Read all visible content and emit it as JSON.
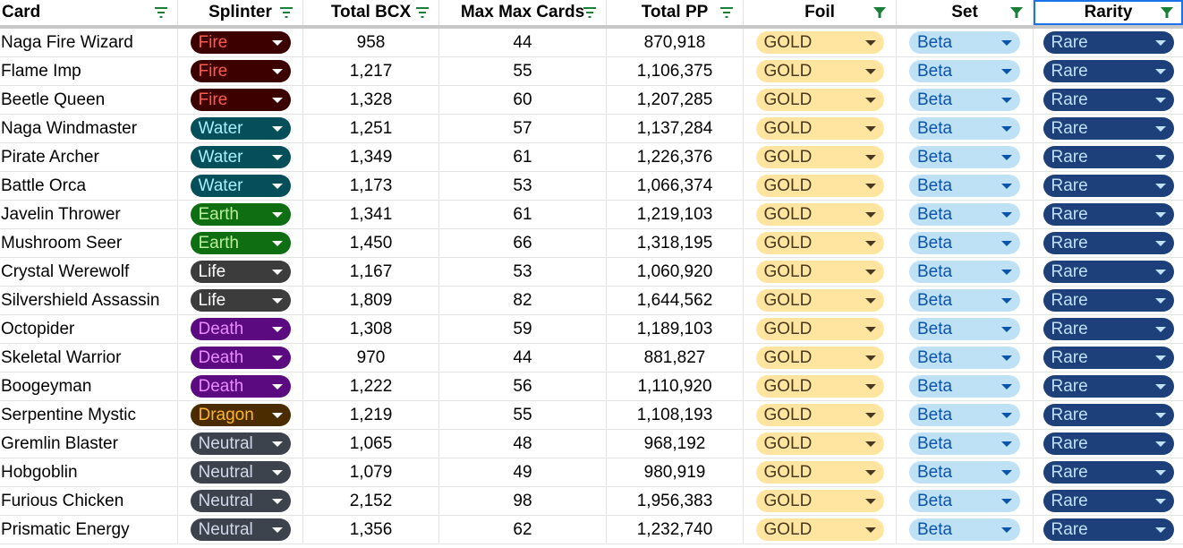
{
  "headers": {
    "card": "Card",
    "splinter": "Splinter",
    "total_bcx": "Total BCX",
    "max_max": "Max Max Cards",
    "total_pp": "Total PP",
    "foil": "Foil",
    "set": "Set",
    "rarity": "Rarity"
  },
  "filter_colors": {
    "inactive": "#188038",
    "active": "#188038"
  },
  "splinter_colors": {
    "Fire": {
      "bg": "#3d0000",
      "fg": "#ff5a4e"
    },
    "Water": {
      "bg": "#064e5a",
      "fg": "#a6f1fa"
    },
    "Earth": {
      "bg": "#0f6d12",
      "fg": "#b7f09a"
    },
    "Life": {
      "bg": "#3c3c3c",
      "fg": "#ffffff"
    },
    "Death": {
      "bg": "#5b0a80",
      "fg": "#e88cff"
    },
    "Dragon": {
      "bg": "#4a2c00",
      "fg": "#ffb428"
    },
    "Neutral": {
      "bg": "#3d434c",
      "fg": "#cfd8e8"
    }
  },
  "rows": [
    {
      "card": "Naga Fire Wizard",
      "splinter": "Fire",
      "bcx": "958",
      "max": "44",
      "pp": "870,918",
      "foil": "GOLD",
      "set": "Beta",
      "rarity": "Rare"
    },
    {
      "card": "Flame Imp",
      "splinter": "Fire",
      "bcx": "1,217",
      "max": "55",
      "pp": "1,106,375",
      "foil": "GOLD",
      "set": "Beta",
      "rarity": "Rare"
    },
    {
      "card": "Beetle Queen",
      "splinter": "Fire",
      "bcx": "1,328",
      "max": "60",
      "pp": "1,207,285",
      "foil": "GOLD",
      "set": "Beta",
      "rarity": "Rare"
    },
    {
      "card": "Naga Windmaster",
      "splinter": "Water",
      "bcx": "1,251",
      "max": "57",
      "pp": "1,137,284",
      "foil": "GOLD",
      "set": "Beta",
      "rarity": "Rare"
    },
    {
      "card": "Pirate Archer",
      "splinter": "Water",
      "bcx": "1,349",
      "max": "61",
      "pp": "1,226,376",
      "foil": "GOLD",
      "set": "Beta",
      "rarity": "Rare"
    },
    {
      "card": "Battle Orca",
      "splinter": "Water",
      "bcx": "1,173",
      "max": "53",
      "pp": "1,066,374",
      "foil": "GOLD",
      "set": "Beta",
      "rarity": "Rare"
    },
    {
      "card": "Javelin Thrower",
      "splinter": "Earth",
      "bcx": "1,341",
      "max": "61",
      "pp": "1,219,103",
      "foil": "GOLD",
      "set": "Beta",
      "rarity": "Rare"
    },
    {
      "card": "Mushroom Seer",
      "splinter": "Earth",
      "bcx": "1,450",
      "max": "66",
      "pp": "1,318,195",
      "foil": "GOLD",
      "set": "Beta",
      "rarity": "Rare"
    },
    {
      "card": "Crystal Werewolf",
      "splinter": "Life",
      "bcx": "1,167",
      "max": "53",
      "pp": "1,060,920",
      "foil": "GOLD",
      "set": "Beta",
      "rarity": "Rare"
    },
    {
      "card": "Silvershield Assassin",
      "splinter": "Life",
      "bcx": "1,809",
      "max": "82",
      "pp": "1,644,562",
      "foil": "GOLD",
      "set": "Beta",
      "rarity": "Rare"
    },
    {
      "card": "Octopider",
      "splinter": "Death",
      "bcx": "1,308",
      "max": "59",
      "pp": "1,189,103",
      "foil": "GOLD",
      "set": "Beta",
      "rarity": "Rare"
    },
    {
      "card": "Skeletal Warrior",
      "splinter": "Death",
      "bcx": "970",
      "max": "44",
      "pp": "881,827",
      "foil": "GOLD",
      "set": "Beta",
      "rarity": "Rare"
    },
    {
      "card": "Boogeyman",
      "splinter": "Death",
      "bcx": "1,222",
      "max": "56",
      "pp": "1,110,920",
      "foil": "GOLD",
      "set": "Beta",
      "rarity": "Rare"
    },
    {
      "card": "Serpentine Mystic",
      "splinter": "Dragon",
      "bcx": "1,219",
      "max": "55",
      "pp": "1,108,193",
      "foil": "GOLD",
      "set": "Beta",
      "rarity": "Rare"
    },
    {
      "card": "Gremlin Blaster",
      "splinter": "Neutral",
      "bcx": "1,065",
      "max": "48",
      "pp": "968,192",
      "foil": "GOLD",
      "set": "Beta",
      "rarity": "Rare"
    },
    {
      "card": "Hobgoblin",
      "splinter": "Neutral",
      "bcx": "1,079",
      "max": "49",
      "pp": "980,919",
      "foil": "GOLD",
      "set": "Beta",
      "rarity": "Rare"
    },
    {
      "card": "Furious Chicken",
      "splinter": "Neutral",
      "bcx": "2,152",
      "max": "98",
      "pp": "1,956,383",
      "foil": "GOLD",
      "set": "Beta",
      "rarity": "Rare"
    },
    {
      "card": "Prismatic Energy",
      "splinter": "Neutral",
      "bcx": "1,356",
      "max": "62",
      "pp": "1,232,740",
      "foil": "GOLD",
      "set": "Beta",
      "rarity": "Rare"
    }
  ]
}
